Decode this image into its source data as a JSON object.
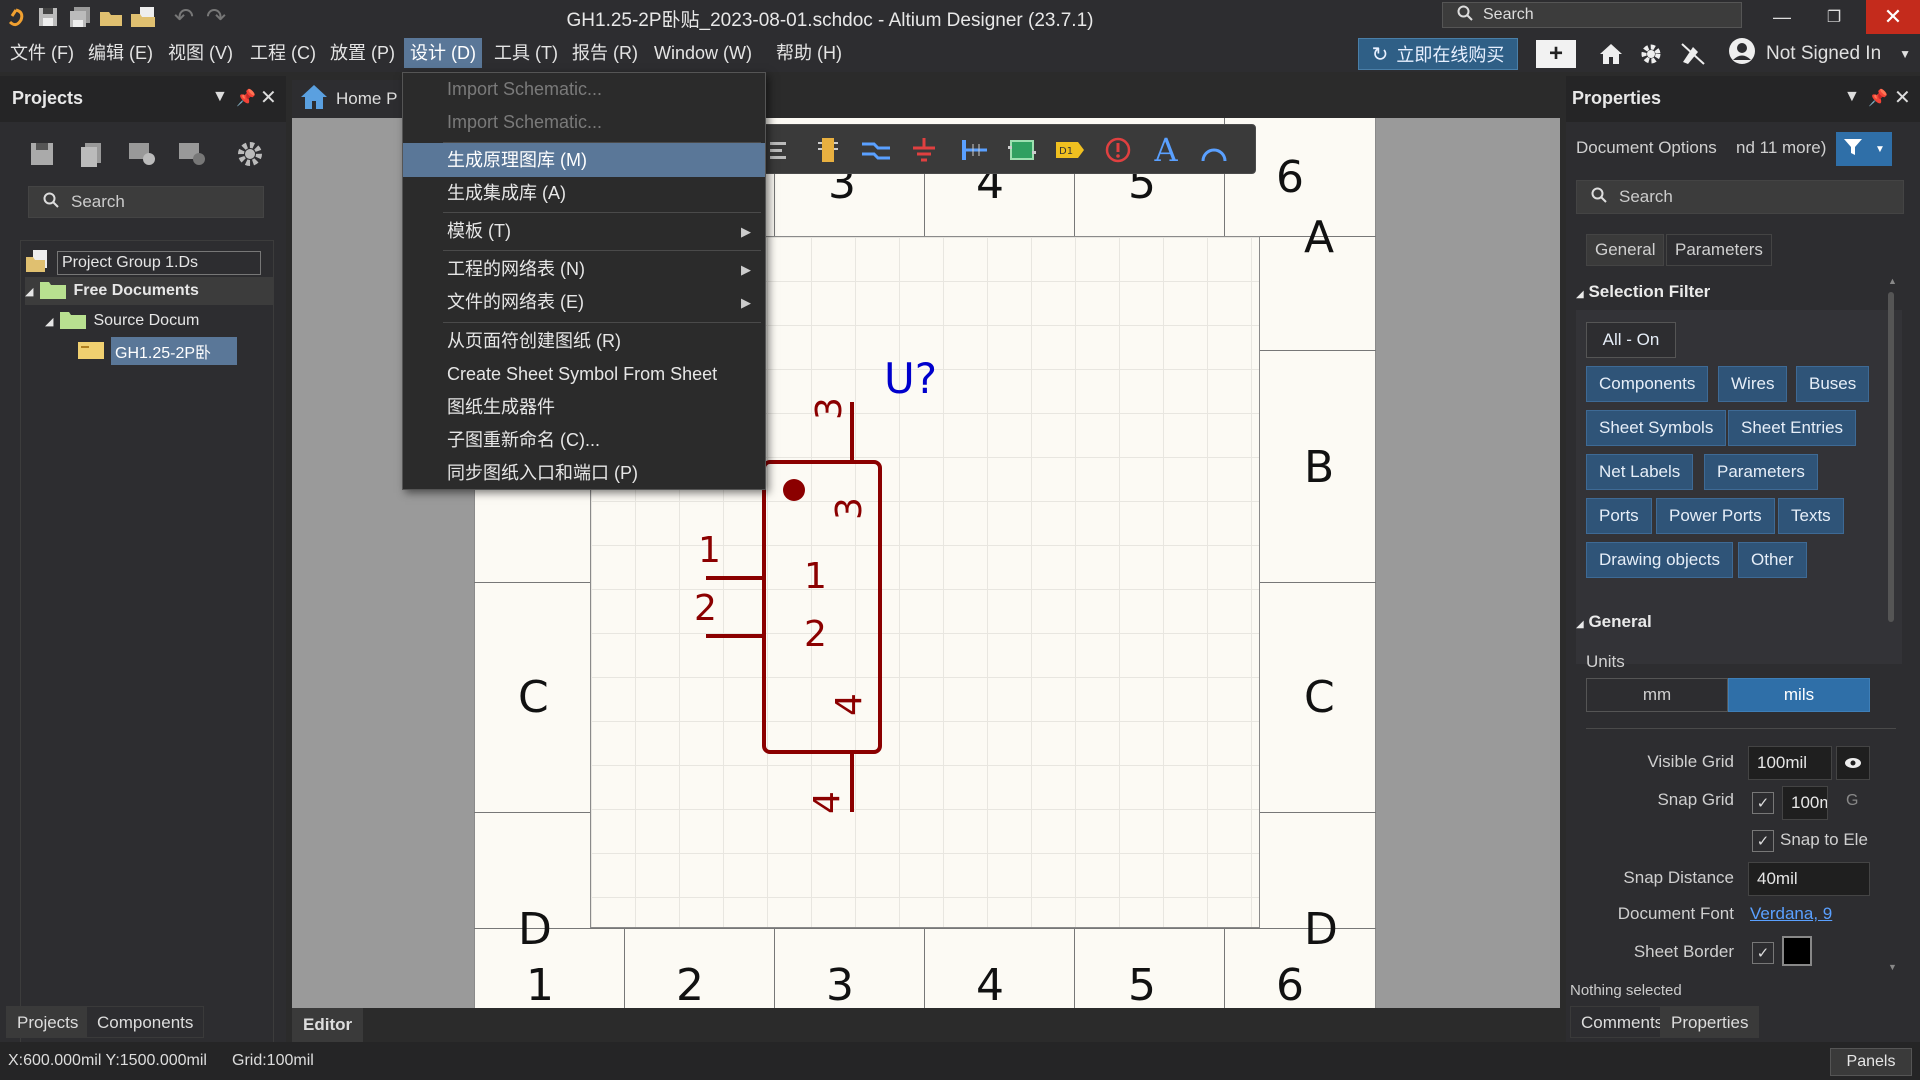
{
  "window": {
    "title": "GH1.25-2P卧贴_2023-08-01.schdoc - Altium Designer (23.7.1)",
    "search_placeholder": "Search"
  },
  "menubar": {
    "items": [
      "文件 (F)",
      "编辑 (E)",
      "视图 (V)",
      "工程 (C)",
      "放置 (P)",
      "设计 (D)",
      "工具 (T)",
      "报告 (R)",
      "Window (W)",
      "帮助 (H)"
    ],
    "buy_label": "立即在线购买",
    "user_label": "Not Signed In"
  },
  "projects_panel": {
    "title": "Projects",
    "search_placeholder": "Search",
    "tree": [
      "Project Group 1.Ds",
      "Free Documents",
      "Source Docum",
      "GH1.25-2P卧"
    ],
    "tabs": [
      "Projects",
      "Components"
    ]
  },
  "editor": {
    "home_tab": "Home P",
    "bottom_tab": "Editor"
  },
  "design_menu": {
    "items": [
      {
        "label": "Import Schematic...",
        "disabled": true
      },
      {
        "label": "Import Schematic...",
        "disabled": true
      },
      {
        "label": "生成原理图库 (M)",
        "highlighted": true
      },
      {
        "label": "生成集成库 (A)"
      },
      {
        "label": "模板 (T)",
        "submenu": true
      },
      {
        "label": "工程的网络表 (N)",
        "submenu": true
      },
      {
        "label": "文件的网络表 (E)",
        "submenu": true
      },
      {
        "label": "从页面符创建图纸 (R)"
      },
      {
        "label": "Create Sheet Symbol From Sheet"
      },
      {
        "label": "图纸生成器件"
      },
      {
        "label": "子图重新命名 (C)..."
      },
      {
        "label": "同步图纸入口和端口 (P)"
      }
    ]
  },
  "sheet": {
    "col_labels": [
      "1",
      "2",
      "3",
      "4",
      "5",
      "6"
    ],
    "row_labels": [
      "A",
      "B",
      "C",
      "D"
    ],
    "visible_top_cols": [
      "3",
      "4",
      "5",
      "6"
    ]
  },
  "schematic": {
    "designator": "U?",
    "pin_labels": [
      "3",
      "1",
      "2",
      "4"
    ],
    "inner_labels": [
      "3",
      "1",
      "2",
      "4"
    ],
    "color": "#8b0000",
    "designator_color": "#0000cc"
  },
  "properties_panel": {
    "title": "Properties",
    "doc_options": "Document Options",
    "doc_more": "nd 11 more)",
    "search_placeholder": "Search",
    "tabs": [
      "General",
      "Parameters"
    ],
    "selection_filter_title": "Selection Filter",
    "all_on": "All - On",
    "filters": [
      "Components",
      "Wires",
      "Buses",
      "Sheet Symbols",
      "Sheet Entries",
      "Net Labels",
      "Parameters",
      "Ports",
      "Power Ports",
      "Texts",
      "Drawing objects",
      "Other"
    ],
    "general_title": "General",
    "units_label": "Units",
    "units": [
      "mm",
      "mils"
    ],
    "visible_grid_label": "Visible Grid",
    "visible_grid_value": "100mil",
    "snap_grid_label": "Snap Grid",
    "snap_grid_value": "100m",
    "snap_grid_key": "G",
    "snap_to_elec": "Snap to Ele",
    "snap_distance_label": "Snap Distance",
    "snap_distance_value": "40mil",
    "doc_font_label": "Document Font",
    "doc_font_value": "Verdana, 9",
    "sheet_border_label": "Sheet Border",
    "nothing_selected": "Nothing selected",
    "bottom_tabs": [
      "Comments",
      "Properties"
    ]
  },
  "status": {
    "coords": "X:600.000mil Y:1500.000mil",
    "grid": "Grid:100mil",
    "panels": "Panels"
  },
  "colors": {
    "accent": "#5a7798",
    "filter_button": "#2f5478",
    "schematic": "#8b0000"
  }
}
